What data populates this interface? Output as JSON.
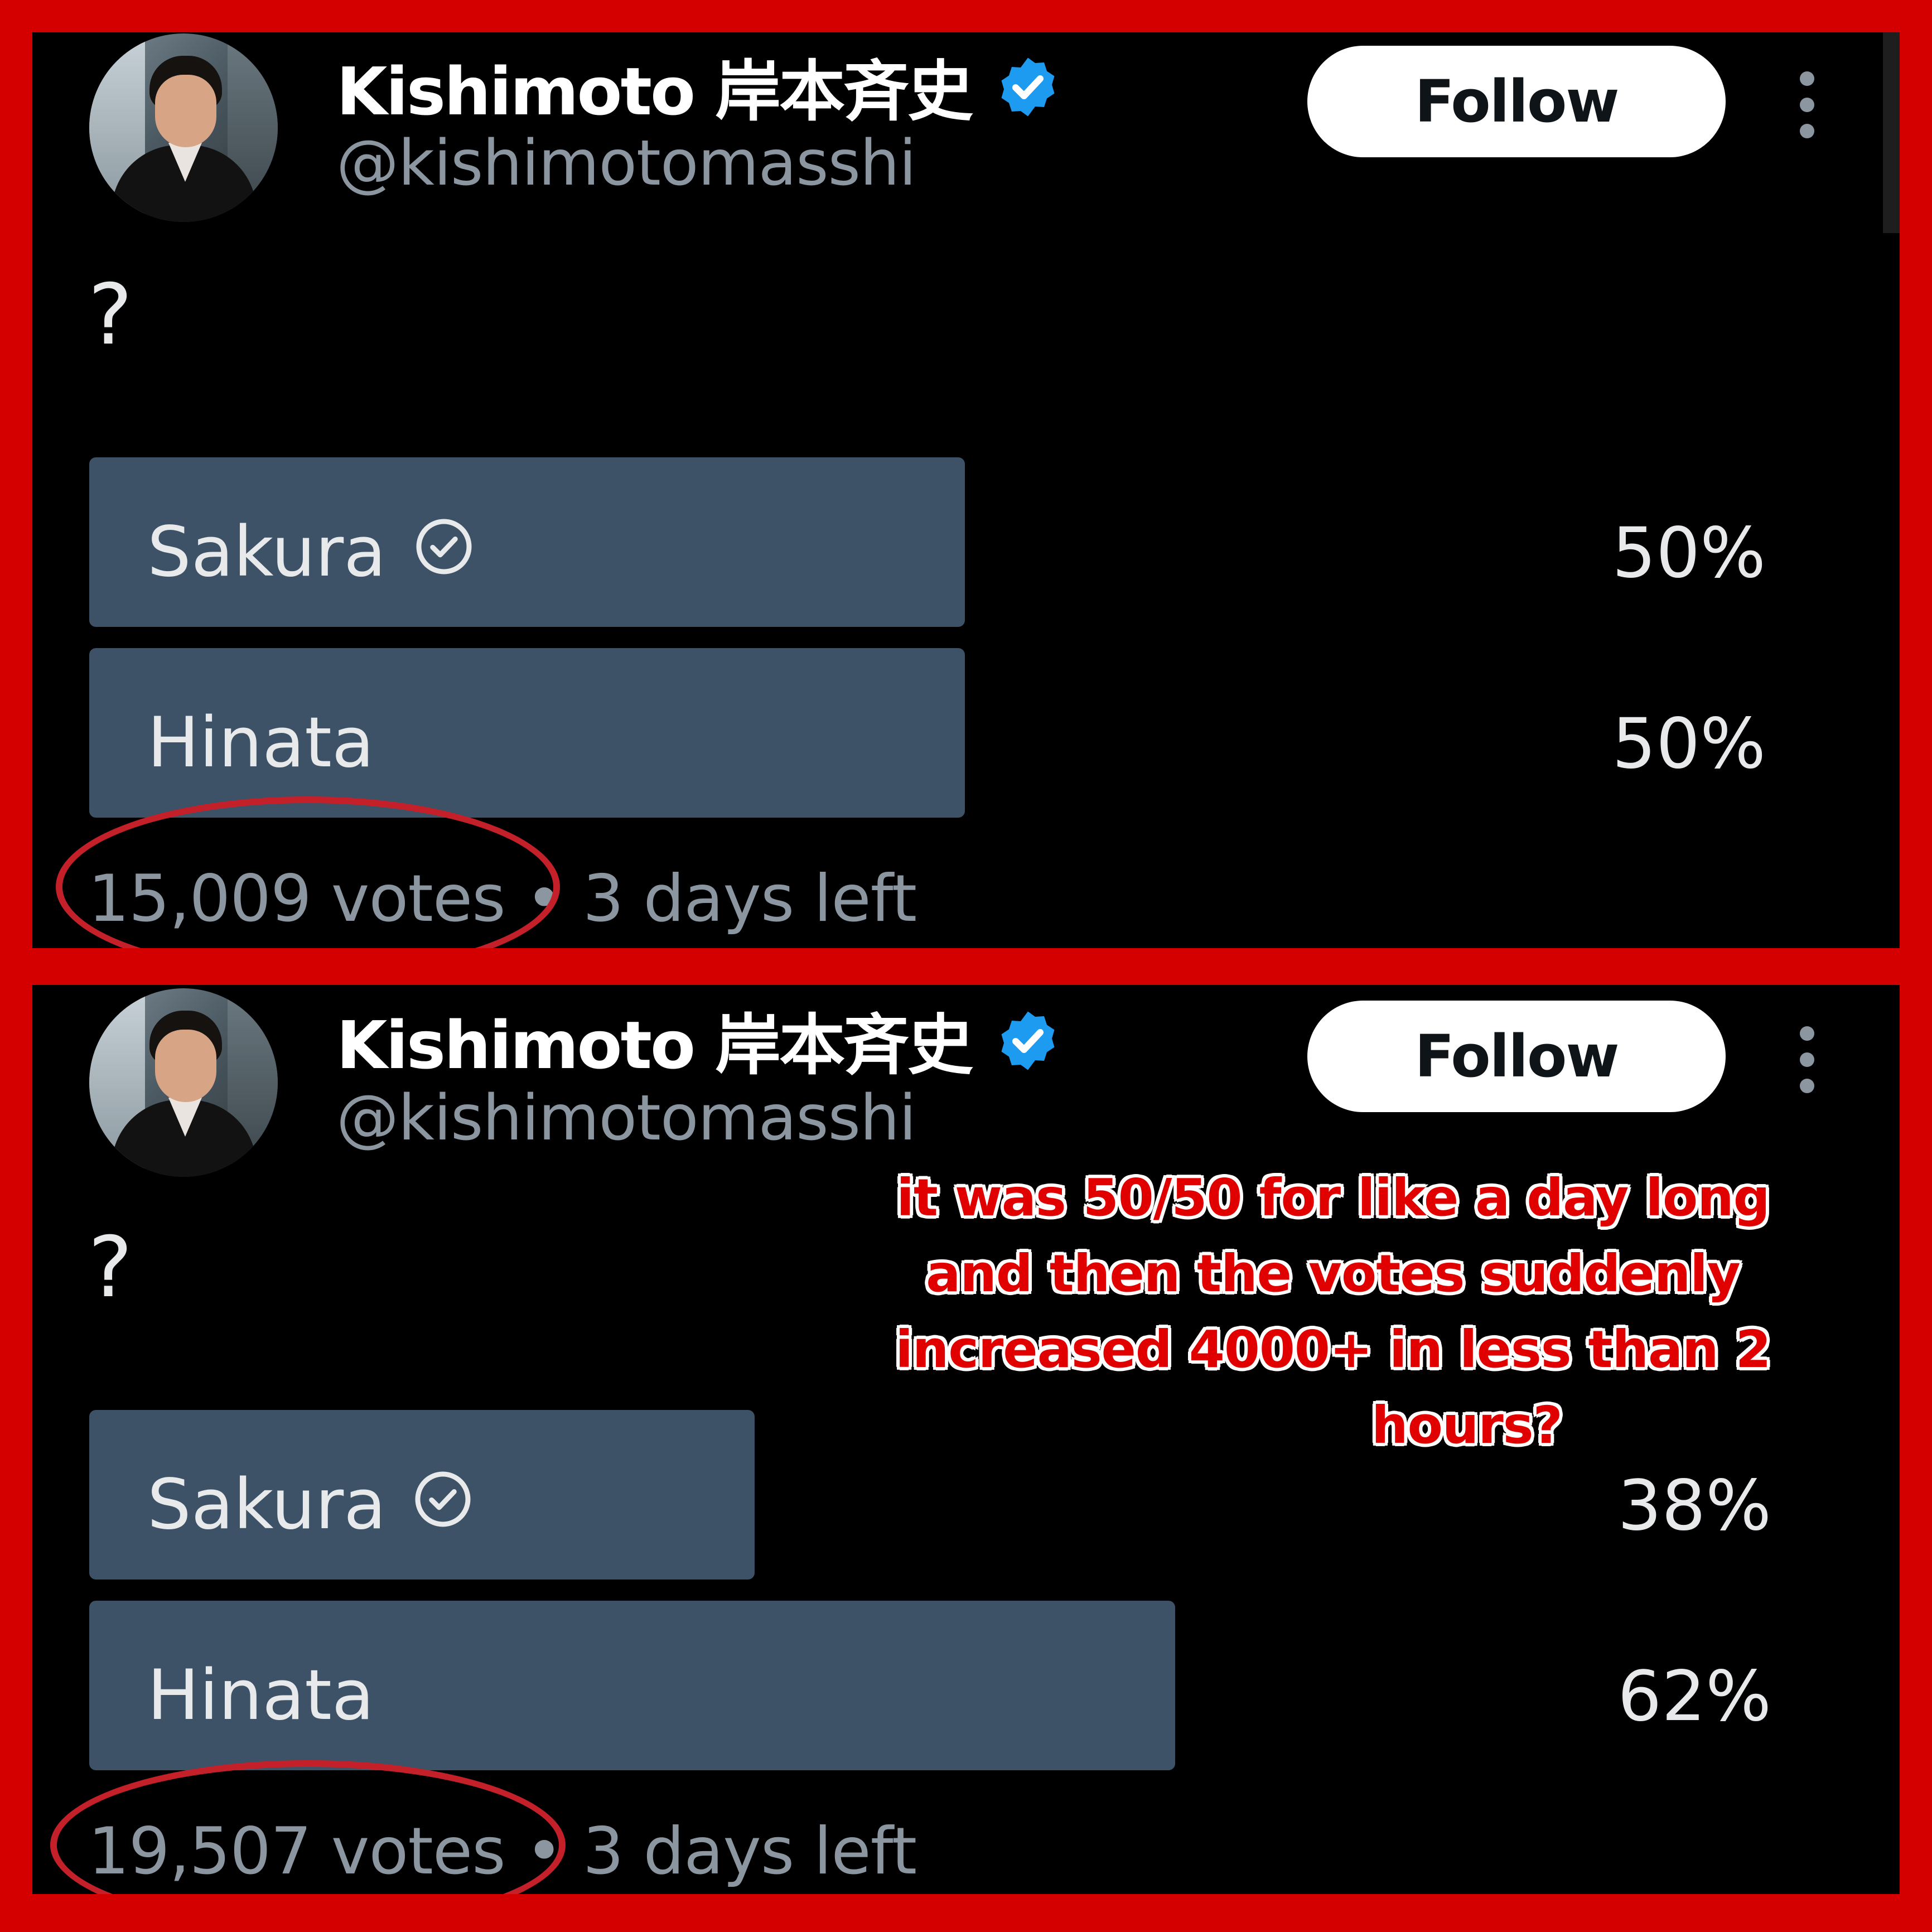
{
  "panels": [
    {
      "author_name": "Kishimoto 岸本斉史",
      "handle": "@kishimotomasshi",
      "follow_label": "Follow",
      "tweet_text": "?",
      "options": [
        {
          "label": "Sakura",
          "percent_label": "50%",
          "percent": 50,
          "selected": true
        },
        {
          "label": "Hinata",
          "percent_label": "50%",
          "percent": 50,
          "selected": false
        }
      ],
      "footer": "15,009 votes • 3 days left"
    },
    {
      "author_name": "Kishimoto 岸本斉史",
      "handle": "@kishimotomasshi",
      "follow_label": "Follow",
      "tweet_text": "?",
      "options": [
        {
          "label": "Sakura",
          "percent_label": "38%",
          "percent": 38,
          "selected": true
        },
        {
          "label": "Hinata",
          "percent_label": "62%",
          "percent": 62,
          "selected": false
        }
      ],
      "footer": "19,507 votes • 3 days left"
    }
  ],
  "annotation": {
    "line1": "it was 50/50 for like a day long",
    "line2": "and then the votes suddenly",
    "line3": "increased 4000+ in less than 2",
    "line4": "hours?"
  },
  "colors": {
    "frame": "#d40000",
    "poll_bar": "#3d5266",
    "verified": "#1d9bf0",
    "circle": "#c4202a",
    "annotation_text": "#e00000"
  },
  "icons": [
    "verified-badge-icon",
    "check-circle-icon",
    "more-options-icon"
  ]
}
